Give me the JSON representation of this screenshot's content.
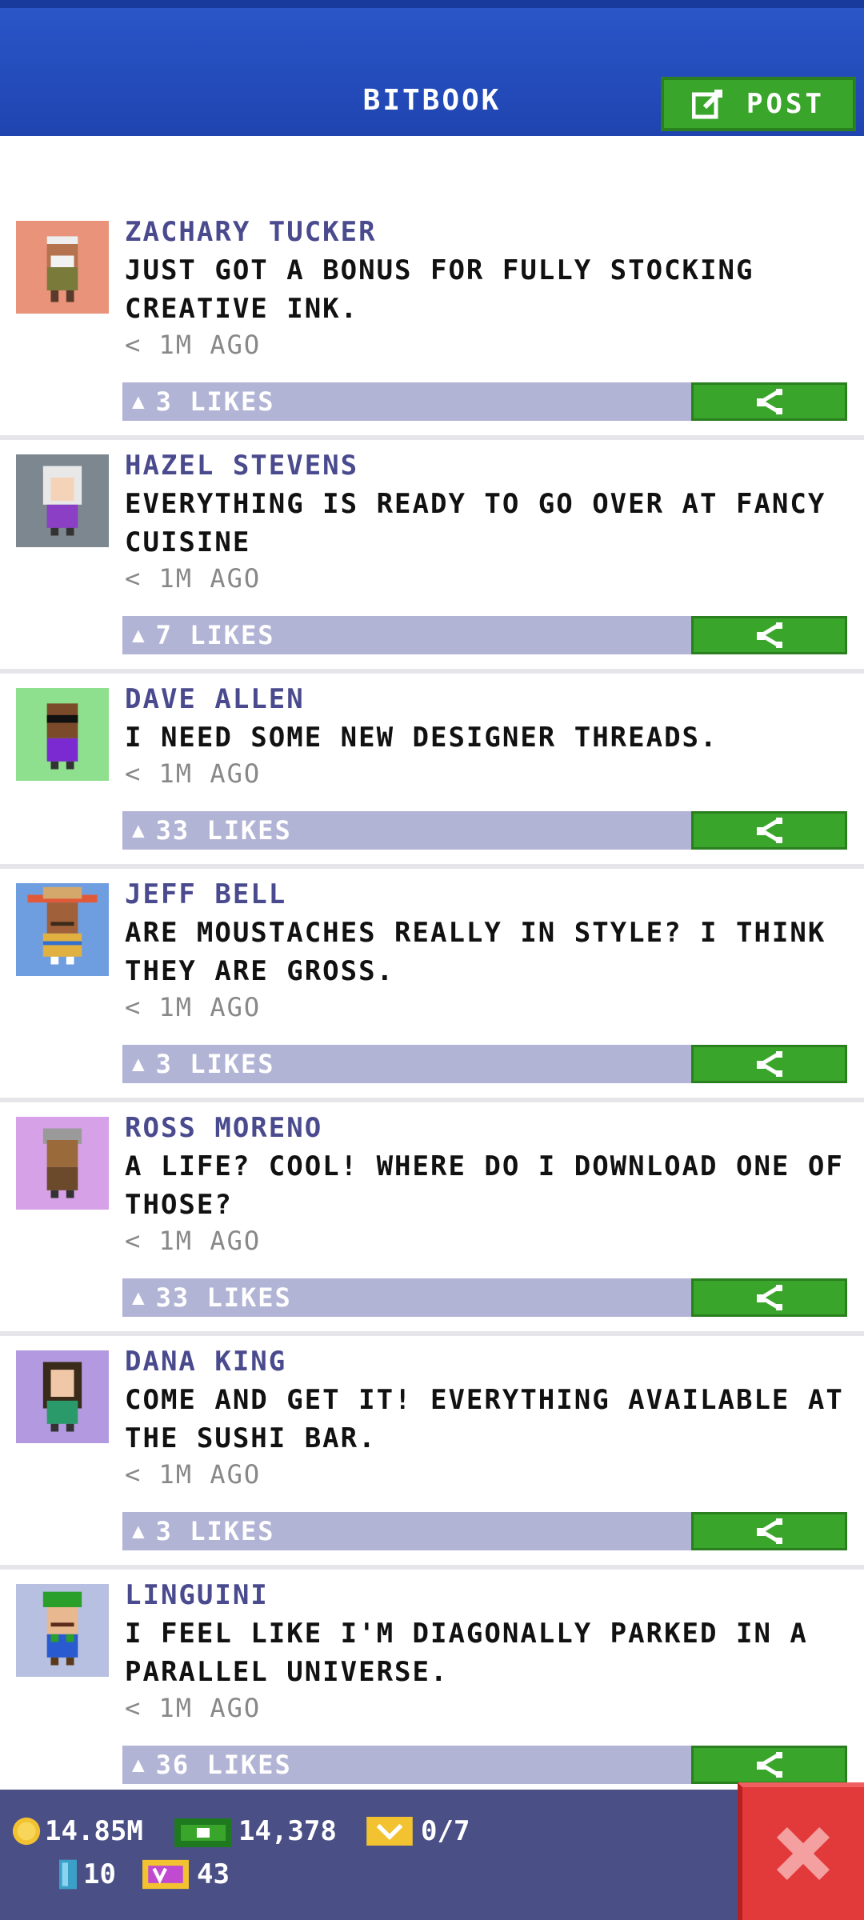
{
  "header": {
    "title": "BITBOOK",
    "post_label": "POST"
  },
  "posts": [
    {
      "author": "ZACHARY TUCKER",
      "message": "JUST GOT A BONUS FOR FULLY STOCKING CREATIVE INK.",
      "time": "1M AGO",
      "likes": "3 LIKES",
      "avatar_bg": "#e8937a"
    },
    {
      "author": "HAZEL STEVENS",
      "message": "EVERYTHING IS READY TO GO OVER AT FANCY CUISINE",
      "time": "1M AGO",
      "likes": "7 LIKES",
      "avatar_bg": "#7c8790"
    },
    {
      "author": "DAVE ALLEN",
      "message": "I NEED SOME NEW DESIGNER THREADS.",
      "time": "1M AGO",
      "likes": "33 LIKES",
      "avatar_bg": "#8ee08e"
    },
    {
      "author": "JEFF BELL",
      "message": "ARE MOUSTACHES REALLY IN STYLE? I THINK THEY ARE GROSS.",
      "time": "1M AGO",
      "likes": "3 LIKES",
      "avatar_bg": "#6f9ee0"
    },
    {
      "author": "ROSS MORENO",
      "message": "A LIFE? COOL! WHERE DO I DOWNLOAD ONE OF THOSE?",
      "time": "1M AGO",
      "likes": "33 LIKES",
      "avatar_bg": "#d6a1e6"
    },
    {
      "author": "DANA KING",
      "message": "COME AND GET IT! EVERYTHING AVAILABLE AT THE SUSHI BAR.",
      "time": "1M AGO",
      "likes": "3 LIKES",
      "avatar_bg": "#b39ae0"
    },
    {
      "author": "LINGUINI",
      "message": "I FEEL LIKE I'M DIAGONALLY PARKED IN A PARALLEL UNIVERSE.",
      "time": "1M AGO",
      "likes": "36 LIKES",
      "avatar_bg": "#b7c0e0"
    }
  ],
  "status": {
    "coins": "14.85M",
    "bux": "14,378",
    "tickets": "0/7",
    "keys": "10",
    "vip": "43"
  },
  "colors": {
    "accent": "#3aa52b",
    "header": "#1f44b0",
    "likes_bar": "#b2b4d6",
    "close": "#e23a3a"
  }
}
